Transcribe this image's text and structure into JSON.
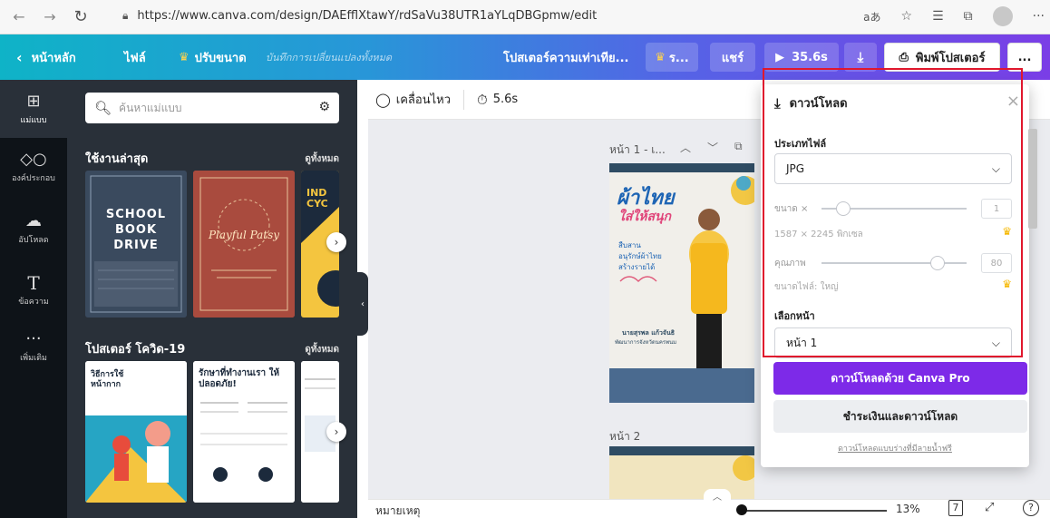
{
  "browser": {
    "url": "https://www.canva.com/design/DAEfflXtawY/rdSaVu38UTR1aYLqDBGpmw/edit",
    "read_aloud": "aあ"
  },
  "topbar": {
    "home": "หน้าหลัก",
    "file": "ไฟล์",
    "resize": "ปรับขนาด",
    "autosave": "บันทึกการเปลี่ยนแปลงทั้งหมด",
    "design_title": "โปสเตอร์ความเท่าเทีย...",
    "pro_pill": "ร...",
    "share": "แชร์",
    "play_time": "35.6s",
    "print": "พิมพ์โปสเตอร์",
    "more": "..."
  },
  "rail": [
    {
      "label": "แม่แบบ",
      "icon": "template-icon"
    },
    {
      "label": "องค์ประกอบ",
      "icon": "elements-icon"
    },
    {
      "label": "อัปโหลด",
      "icon": "upload-icon"
    },
    {
      "label": "ข้อความ",
      "icon": "text-icon"
    },
    {
      "label": "เพิ่มเติม",
      "icon": "more-icon"
    }
  ],
  "panel": {
    "search_placeholder": "ค้นหาแม่แบบ",
    "recent_title": "ใช้งานล่าสุด",
    "recent_see_all": "ดูทั้งหมด",
    "covid_title": "โปสเตอร์ โควิด-19",
    "covid_see_all": "ดูทั้งหมด",
    "thumbs": {
      "school": "SCHOOL BOOK DRIVE",
      "patsy": "Playful Patsy",
      "indie_1": "IND",
      "indie_2": "CYC",
      "covid1_title": "วิธีการใช้หน้ากาก",
      "covid2_title": "รักษาที่ทำงานเรา ให้ปลอดภัย!"
    }
  },
  "toolbar": {
    "animate": "เคลื่อนไหว",
    "timing": "5.6s"
  },
  "canvas": {
    "page1_label": "หน้า 1 - เ...",
    "page2_label": "หน้า 2",
    "poster": {
      "title1": "ผ้าไทย",
      "title2": "ใส่ให้สนุก",
      "sub1": "สืบสาน",
      "sub2": "อนุรักษ์ผ้าไทย",
      "sub3": "สร้างรายได้",
      "name": "นายสุรพล แก้วจันธิ",
      "role": "พัฒนาการจังหวัดนครพนม"
    }
  },
  "download": {
    "heading": "ดาวน์โหลด",
    "file_type_label": "ประเภทไฟล์",
    "file_type_value": "JPG",
    "size_label": "ขนาด ×",
    "size_value": "1",
    "dims": "1587 × 2245 พิกเซล",
    "quality_label": "คุณภาพ",
    "quality_value": "80",
    "file_size": "ขนาดไฟล์: ใหญ่",
    "pages_label": "เลือกหน้า",
    "pages_value": "หน้า 1",
    "pro_button": "ดาวน์โหลดด้วย Canva Pro",
    "pay_button": "ชำระเงินและดาวน์โหลด",
    "free_link": "ดาวน์โหลดแบบร่างที่มีลายน้ำฟรี",
    "size_fraction": 0.15,
    "quality_fraction": 0.8
  },
  "bottom": {
    "notes": "หมายเหตุ",
    "zoom": "13%",
    "page_count": "7",
    "help": "?"
  },
  "colors": {
    "accent_purple": "#7d2ae8",
    "highlight_red": "#e0172d",
    "crown_gold": "#f6b800"
  }
}
